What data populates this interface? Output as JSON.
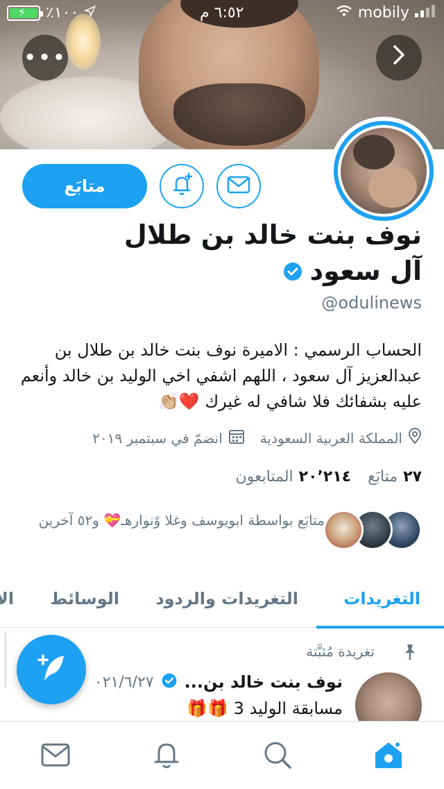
{
  "status_bar": {
    "carrier": "mobily",
    "time": "٦:٥٢ م",
    "battery": "٪١٠٠"
  },
  "profile": {
    "name": "نوف بنت خالد بن طلال آل سعود",
    "handle": "@odulinews",
    "verified": true,
    "bio": "الحساب الرسمي : الاميرة نوف بنت خالد بن طلال بن عبدالعزيز آل سعود ، اللهم اشفي اخي الوليد بن خالد وأنعم عليه بشفائك فلا شافي له غيرك ❤️👏🏼",
    "location": "المملكة العربية السعودية",
    "joined": "انضمّ في سبتمبر ٢٠١٩",
    "following_count": "٢٧",
    "following_label": "متابَع",
    "followers_count": "٢٠٬٢١٤",
    "followers_label": "المتابعون",
    "followed_by_text": "متابَع بواسطة ابويوسف وغلا وًنوارهـ💝 و٥٢ آخرين"
  },
  "actions": {
    "follow_label": "متابَع"
  },
  "tabs": [
    {
      "label": "التغريدات",
      "active": true
    },
    {
      "label": "التغريدات والردود",
      "active": false
    },
    {
      "label": "الوسائط",
      "active": false
    },
    {
      "label": "الإ",
      "active": false
    }
  ],
  "pinned_tweet": {
    "label": "تغريدة مُثبَّتة",
    "author": "نوف بنت خالد بن...",
    "date": "٠٢١/٦/٢٧",
    "text": "مسابقة الوليد 3 🎁🎁"
  },
  "colors": {
    "accent": "#1da1f2",
    "secondary_text": "#657786"
  },
  "icons": {
    "more": "more-dots-icon",
    "forward": "chevron-right-icon",
    "bell": "bell-plus-icon",
    "mail": "envelope-icon",
    "location": "location-pin-icon",
    "calendar": "calendar-icon",
    "pin": "pin-icon",
    "compose": "feather-plus-icon"
  }
}
